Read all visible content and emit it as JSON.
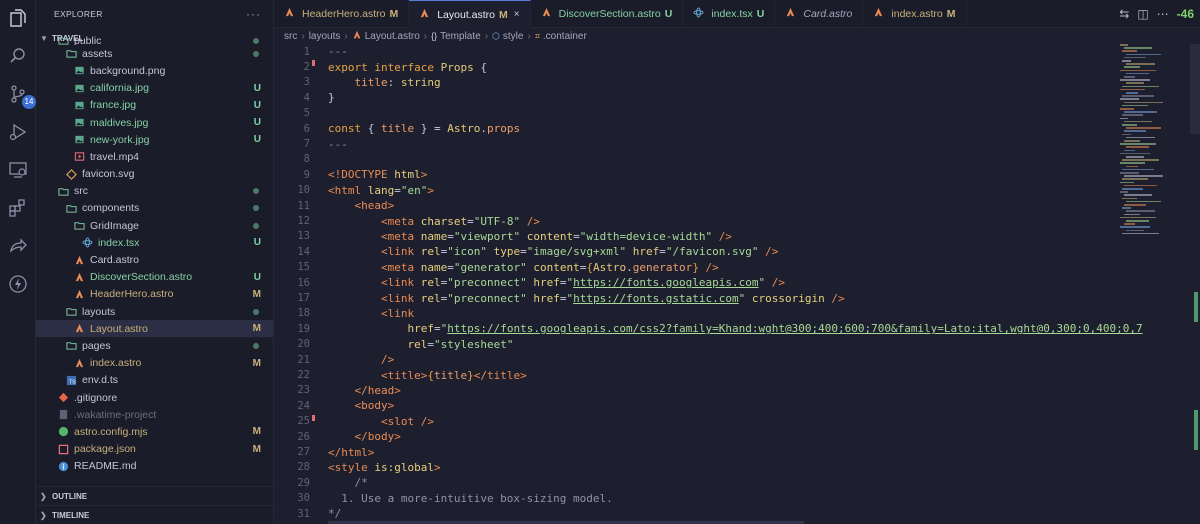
{
  "sidebar": {
    "title": "EXPLORER",
    "more": "···",
    "project": "TRAVEL",
    "source_control_badge": "14",
    "items": [
      {
        "label": "public",
        "depth": 1,
        "kind": "folder-open",
        "status": "",
        "dot": true
      },
      {
        "label": "assets",
        "depth": 2,
        "kind": "folder-open",
        "status": "",
        "dot": true
      },
      {
        "label": "background.png",
        "depth": 3,
        "kind": "image",
        "status": ""
      },
      {
        "label": "california.jpg",
        "depth": 3,
        "kind": "image",
        "status": "U"
      },
      {
        "label": "france.jpg",
        "depth": 3,
        "kind": "image",
        "status": "U"
      },
      {
        "label": "maldives.jpg",
        "depth": 3,
        "kind": "image",
        "status": "U"
      },
      {
        "label": "new-york.jpg",
        "depth": 3,
        "kind": "image",
        "status": "U"
      },
      {
        "label": "travel.mp4",
        "depth": 3,
        "kind": "video",
        "status": ""
      },
      {
        "label": "favicon.svg",
        "depth": 2,
        "kind": "svg",
        "status": ""
      },
      {
        "label": "src",
        "depth": 1,
        "kind": "folder-open",
        "status": "",
        "dot": true
      },
      {
        "label": "components",
        "depth": 2,
        "kind": "folder-open",
        "status": "",
        "dot": true
      },
      {
        "label": "GridImage",
        "depth": 3,
        "kind": "folder-open",
        "status": "",
        "dot": true
      },
      {
        "label": "index.tsx",
        "depth": 4,
        "kind": "tsx",
        "status": "U"
      },
      {
        "label": "Card.astro",
        "depth": 3,
        "kind": "astro",
        "status": ""
      },
      {
        "label": "DiscoverSection.astro",
        "depth": 3,
        "kind": "astro",
        "status": "U"
      },
      {
        "label": "HeaderHero.astro",
        "depth": 3,
        "kind": "astro",
        "status": "M"
      },
      {
        "label": "layouts",
        "depth": 2,
        "kind": "folder-open",
        "status": "",
        "dot": true
      },
      {
        "label": "Layout.astro",
        "depth": 3,
        "kind": "astro",
        "status": "M",
        "selected": true
      },
      {
        "label": "pages",
        "depth": 2,
        "kind": "folder-open",
        "status": "",
        "dot": true
      },
      {
        "label": "index.astro",
        "depth": 3,
        "kind": "astro",
        "status": "M"
      },
      {
        "label": "env.d.ts",
        "depth": 2,
        "kind": "ts",
        "status": ""
      },
      {
        "label": ".gitignore",
        "depth": 1,
        "kind": "git",
        "status": ""
      },
      {
        "label": ".wakatime-project",
        "depth": 1,
        "kind": "file",
        "status": "",
        "dim": true
      },
      {
        "label": "astro.config.mjs",
        "depth": 1,
        "kind": "js",
        "status": "M"
      },
      {
        "label": "package.json",
        "depth": 1,
        "kind": "json",
        "status": "M"
      },
      {
        "label": "README.md",
        "depth": 1,
        "kind": "info",
        "status": ""
      }
    ],
    "outline": "OUTLINE",
    "timeline": "TIMELINE"
  },
  "tabs": [
    {
      "label": "HeaderHero.astro",
      "badge": "M",
      "active": false,
      "italic": false
    },
    {
      "label": "Layout.astro",
      "badge": "M",
      "active": true,
      "italic": false,
      "close": "×"
    },
    {
      "label": "DiscoverSection.astro",
      "badge": "U",
      "active": false,
      "italic": false
    },
    {
      "label": "index.tsx",
      "badge": "U",
      "active": false,
      "italic": false
    },
    {
      "label": "Card.astro",
      "badge": "",
      "active": false,
      "italic": true
    },
    {
      "label": "index.astro",
      "badge": "M",
      "active": false,
      "italic": false
    }
  ],
  "tab_actions": {
    "counter": "-46"
  },
  "breadcrumb": [
    "src",
    "layouts",
    "Layout.astro",
    "Template",
    "style",
    ".container"
  ],
  "editor": {
    "current_line": 32,
    "lines": [
      [
        [
          "cm",
          "---"
        ]
      ],
      [
        [
          "kw",
          "export interface "
        ],
        [
          "ty",
          "Props"
        ],
        [
          "pu",
          " {"
        ]
      ],
      [
        [
          "pu",
          "    "
        ],
        [
          "var",
          "title"
        ],
        [
          "pu",
          ": "
        ],
        [
          "ty",
          "string"
        ]
      ],
      [
        [
          "pu",
          "}"
        ]
      ],
      [],
      [
        [
          "kw",
          "const "
        ],
        [
          "pu",
          "{ "
        ],
        [
          "var",
          "title"
        ],
        [
          "pu",
          " } = "
        ],
        [
          "ty",
          "Astro"
        ],
        [
          "pu",
          "."
        ],
        [
          "var",
          "props"
        ]
      ],
      [
        [
          "cm",
          "---"
        ]
      ],
      [],
      [
        [
          "tag",
          "<!DOCTYPE "
        ],
        [
          "attr",
          "html"
        ],
        [
          "tag",
          ">"
        ]
      ],
      [
        [
          "tag",
          "<html "
        ],
        [
          "attr",
          "lang"
        ],
        [
          "pu",
          "="
        ],
        [
          "str",
          "\"en\""
        ],
        [
          "tag",
          ">"
        ]
      ],
      [
        [
          "pu",
          "    "
        ],
        [
          "tag",
          "<head>"
        ]
      ],
      [
        [
          "pu",
          "        "
        ],
        [
          "tag",
          "<meta "
        ],
        [
          "attr",
          "charset"
        ],
        [
          "pu",
          "="
        ],
        [
          "str",
          "\"UTF-8\""
        ],
        [
          "tag",
          " />"
        ]
      ],
      [
        [
          "pu",
          "        "
        ],
        [
          "tag",
          "<meta "
        ],
        [
          "attr",
          "name"
        ],
        [
          "pu",
          "="
        ],
        [
          "str",
          "\"viewport\""
        ],
        [
          "attr",
          " content"
        ],
        [
          "pu",
          "="
        ],
        [
          "str",
          "\"width=device-width\""
        ],
        [
          "tag",
          " />"
        ]
      ],
      [
        [
          "pu",
          "        "
        ],
        [
          "tag",
          "<link "
        ],
        [
          "attr",
          "rel"
        ],
        [
          "pu",
          "="
        ],
        [
          "str",
          "\"icon\""
        ],
        [
          "attr",
          " type"
        ],
        [
          "pu",
          "="
        ],
        [
          "str",
          "\"image/svg+xml\""
        ],
        [
          "attr",
          " href"
        ],
        [
          "pu",
          "="
        ],
        [
          "str",
          "\"/favicon.svg\""
        ],
        [
          "tag",
          " />"
        ]
      ],
      [
        [
          "pu",
          "        "
        ],
        [
          "tag",
          "<meta "
        ],
        [
          "attr",
          "name"
        ],
        [
          "pu",
          "="
        ],
        [
          "str",
          "\"generator\""
        ],
        [
          "attr",
          " content"
        ],
        [
          "pu",
          "="
        ],
        [
          "kw",
          "{"
        ],
        [
          "ty",
          "Astro"
        ],
        [
          "pu",
          "."
        ],
        [
          "var",
          "generator"
        ],
        [
          "kw",
          "}"
        ],
        [
          "tag",
          " />"
        ]
      ],
      [
        [
          "pu",
          "        "
        ],
        [
          "tag",
          "<link "
        ],
        [
          "attr",
          "rel"
        ],
        [
          "pu",
          "="
        ],
        [
          "str",
          "\"preconnect\""
        ],
        [
          "attr",
          " href"
        ],
        [
          "pu",
          "="
        ],
        [
          "str",
          "\""
        ],
        [
          "url",
          "https://fonts.googleapis.com"
        ],
        [
          "str",
          "\""
        ],
        [
          "tag",
          " />"
        ]
      ],
      [
        [
          "pu",
          "        "
        ],
        [
          "tag",
          "<link "
        ],
        [
          "attr",
          "rel"
        ],
        [
          "pu",
          "="
        ],
        [
          "str",
          "\"preconnect\""
        ],
        [
          "attr",
          " href"
        ],
        [
          "pu",
          "="
        ],
        [
          "str",
          "\""
        ],
        [
          "url",
          "https://fonts.gstatic.com"
        ],
        [
          "str",
          "\""
        ],
        [
          "attr",
          " crossorigin"
        ],
        [
          "tag",
          " />"
        ]
      ],
      [
        [
          "pu",
          "        "
        ],
        [
          "tag",
          "<link"
        ]
      ],
      [
        [
          "pu",
          "            "
        ],
        [
          "attr",
          "href"
        ],
        [
          "pu",
          "="
        ],
        [
          "str",
          "\""
        ],
        [
          "url",
          "https://fonts.googleapis.com/css2?family=Khand:wght@300;400;600;700&family=Lato:ital,wght@0,300;0,400;0,7"
        ]
      ],
      [
        [
          "pu",
          "            "
        ],
        [
          "attr",
          "rel"
        ],
        [
          "pu",
          "="
        ],
        [
          "str",
          "\"stylesheet\""
        ]
      ],
      [
        [
          "pu",
          "        "
        ],
        [
          "tag",
          "/>"
        ]
      ],
      [
        [
          "pu",
          "        "
        ],
        [
          "tag",
          "<title>"
        ],
        [
          "kw",
          "{"
        ],
        [
          "var",
          "title"
        ],
        [
          "kw",
          "}"
        ],
        [
          "tag",
          "</title>"
        ]
      ],
      [
        [
          "pu",
          "    "
        ],
        [
          "tag",
          "</head>"
        ]
      ],
      [
        [
          "pu",
          "    "
        ],
        [
          "tag",
          "<body>"
        ]
      ],
      [
        [
          "pu",
          "        "
        ],
        [
          "tag",
          "<slot"
        ],
        [
          "tag",
          " />"
        ]
      ],
      [
        [
          "pu",
          "    "
        ],
        [
          "tag",
          "</body>"
        ]
      ],
      [
        [
          "tag",
          "</html>"
        ]
      ],
      [
        [
          "tag",
          "<style "
        ],
        [
          "attr",
          "is:global"
        ],
        [
          "tag",
          ">"
        ]
      ],
      [
        [
          "pu",
          "    "
        ],
        [
          "cm",
          "/*"
        ]
      ],
      [
        [
          "cm",
          "  1. Use a more-intuitive box-sizing model."
        ]
      ],
      [
        [
          "cm",
          "*/"
        ]
      ],
      [
        [
          "pu",
          "    "
        ],
        [
          "tag",
          "*"
        ],
        [
          "pu",
          ","
        ]
      ]
    ]
  },
  "colors": {
    "accent": "#5d7bd6",
    "untracked": "#84d2a3",
    "modified": "#c7b07a",
    "astro": "#e98b53"
  }
}
